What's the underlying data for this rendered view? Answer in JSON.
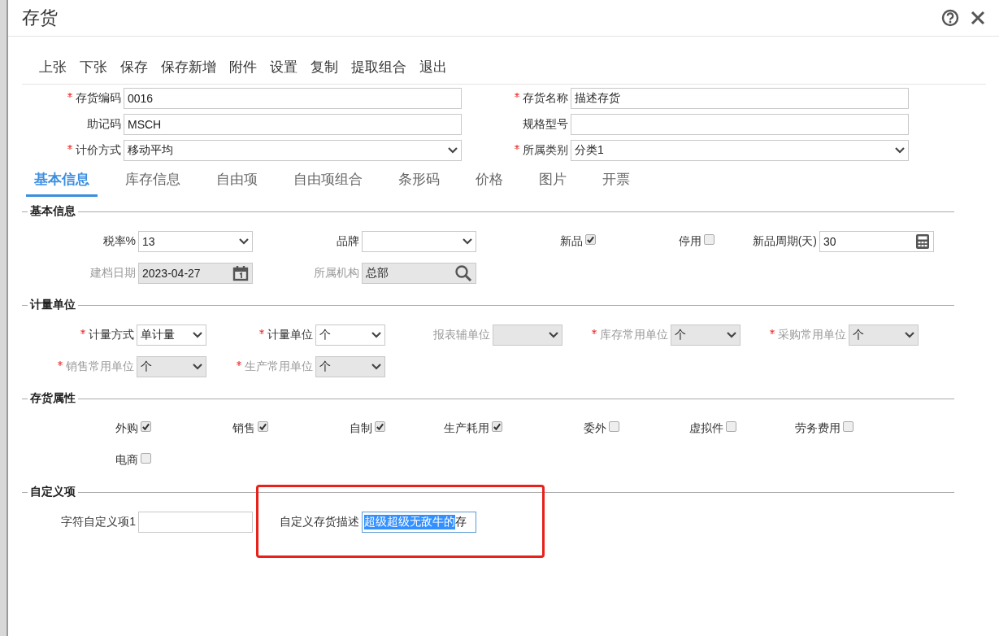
{
  "window": {
    "title": "存货"
  },
  "toolbar": [
    "上张",
    "下张",
    "保存",
    "保存新增",
    "附件",
    "设置",
    "复制",
    "提取组合",
    "退出"
  ],
  "header_fields": [
    {
      "label": "存货编码",
      "required": true,
      "kind": "input",
      "value": "0016"
    },
    {
      "label": "存货名称",
      "required": true,
      "kind": "input",
      "value": "描述存货"
    },
    {
      "label": "助记码",
      "required": false,
      "kind": "input",
      "value": "MSCH"
    },
    {
      "label": "规格型号",
      "required": false,
      "kind": "input"
    },
    {
      "label": "计价方式",
      "required": true,
      "kind": "select",
      "value": "移动平均"
    },
    {
      "label": "所属类别",
      "required": true,
      "kind": "select",
      "value": "分类1"
    }
  ],
  "tabs": [
    {
      "label": "基本信息",
      "selected": true
    },
    {
      "label": "库存信息",
      "selected": false
    },
    {
      "label": "自由项",
      "selected": false
    },
    {
      "label": "自由项组合",
      "selected": false
    },
    {
      "label": "条形码",
      "selected": false
    },
    {
      "label": "价格",
      "selected": false
    },
    {
      "label": "图片",
      "selected": false
    },
    {
      "label": "开票",
      "selected": false
    }
  ],
  "sections": [
    {
      "title": "基本信息",
      "kind": "basic",
      "rows": [
        [
          {
            "label": "税率%",
            "required": false,
            "disabled": false,
            "kind": "select",
            "value": "13"
          },
          {
            "label": "品牌",
            "required": false,
            "disabled": false,
            "kind": "select"
          },
          {
            "label": "新品",
            "kind": "checkbox",
            "checked": true
          },
          {
            "label": "停用",
            "kind": "checkbox",
            "checked": false
          },
          {
            "label": "新品周期(天)",
            "required": false,
            "disabled": false,
            "kind": "number",
            "value": "30"
          }
        ],
        [
          {
            "label": "建档日期",
            "required": false,
            "disabled": true,
            "kind": "date",
            "value": "2023-04-27"
          },
          {
            "label": "所属机构",
            "required": false,
            "disabled": true,
            "kind": "lookup",
            "value": "总部"
          }
        ]
      ]
    },
    {
      "title": "计量单位",
      "kind": "units",
      "rows": [
        [
          {
            "label": "计量方式",
            "required": true,
            "disabled": false,
            "kind": "select",
            "value": "单计量"
          },
          {
            "label": "计量单位",
            "required": true,
            "disabled": false,
            "kind": "select",
            "value": "个"
          },
          {
            "label": "报表辅单位",
            "required": false,
            "disabled": true,
            "kind": "select"
          },
          {
            "label": "库存常用单位",
            "required": true,
            "disabled": true,
            "kind": "select",
            "value": "个"
          },
          {
            "label": "采购常用单位",
            "required": true,
            "disabled": true,
            "kind": "select",
            "value": "个"
          }
        ],
        [
          {
            "label": "销售常用单位",
            "required": true,
            "disabled": true,
            "kind": "select",
            "value": "个"
          },
          {
            "label": "生产常用单位",
            "required": true,
            "disabled": true,
            "kind": "select",
            "value": "个"
          }
        ]
      ]
    },
    {
      "title": "存货属性",
      "kind": "attributes",
      "rows": [
        [
          {
            "label": "外购",
            "kind": "checkbox",
            "checked": true
          },
          {
            "label": "销售",
            "kind": "checkbox",
            "checked": true
          },
          {
            "label": "自制",
            "kind": "checkbox",
            "checked": true
          },
          {
            "label": "生产耗用",
            "kind": "checkbox",
            "checked": true
          },
          {
            "label": "委外",
            "kind": "checkbox",
            "checked": false
          },
          {
            "label": "虚拟件",
            "kind": "checkbox",
            "checked": false
          },
          {
            "label": "劳务费用",
            "kind": "checkbox",
            "checked": false
          }
        ],
        [
          {
            "label": "电商",
            "kind": "checkbox",
            "checked": false
          }
        ]
      ]
    },
    {
      "title": "自定义项",
      "kind": "custom",
      "rows": [
        [
          {
            "label": "字符自定义项1",
            "required": false,
            "disabled": false,
            "kind": "input"
          },
          {
            "label": "自定义存货描述",
            "required": false,
            "disabled": false,
            "kind": "selection",
            "selected_text": "超级超级无敌牛的",
            "text_after": "存",
            "annotated": true
          }
        ]
      ]
    }
  ]
}
